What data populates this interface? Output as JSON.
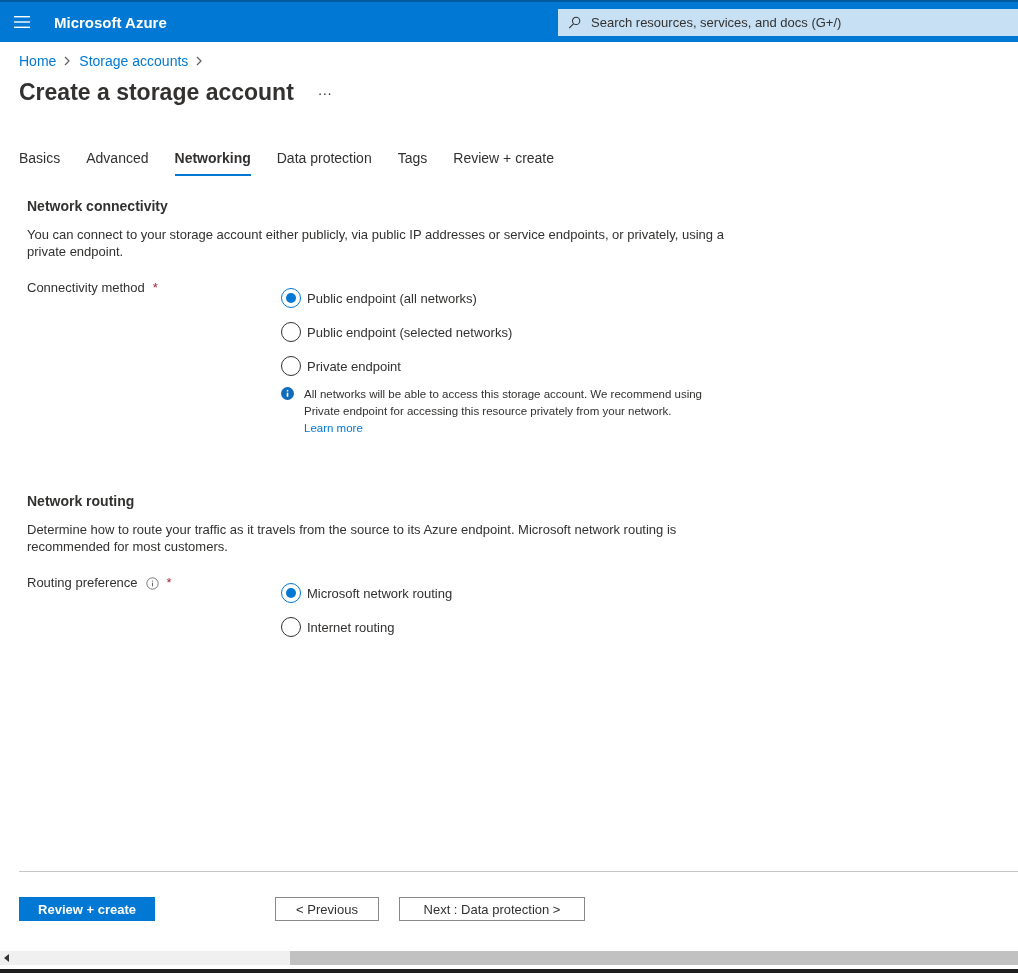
{
  "header": {
    "brand": "Microsoft Azure",
    "search": {
      "placeholder": "Search resources, services, and docs (G+/)"
    }
  },
  "breadcrumb": [
    "Home",
    "Storage accounts"
  ],
  "title": "Create a storage account",
  "more": "···",
  "tabs": [
    {
      "label": "Basics",
      "selected": false
    },
    {
      "label": "Advanced",
      "selected": false
    },
    {
      "label": "Networking",
      "selected": true
    },
    {
      "label": "Data protection",
      "selected": false
    },
    {
      "label": "Tags",
      "selected": false
    },
    {
      "label": "Review + create",
      "selected": false
    }
  ],
  "sections": [
    {
      "heading": "Network connectivity",
      "description": "You can connect to your storage account either publicly, via public IP addresses or service endpoints, or privately, using a private endpoint.",
      "field": {
        "label": "Connectivity method",
        "required": "*",
        "has_info": false,
        "options": [
          {
            "label": "Public endpoint (all networks)",
            "selected": true
          },
          {
            "label": "Public endpoint (selected networks)",
            "selected": false
          },
          {
            "label": "Private endpoint",
            "selected": false
          }
        ],
        "note": {
          "text": "All networks will be able to access this storage account. We recommend using Private endpoint for accessing this resource privately from your network.",
          "link": "Learn more"
        }
      }
    },
    {
      "heading": "Network routing",
      "description": "Determine how to route your traffic as it travels from the source to its Azure endpoint. Microsoft network routing is recommended for most customers.",
      "field": {
        "label": "Routing preference",
        "required": "*",
        "has_info": true,
        "options": [
          {
            "label": "Microsoft network routing",
            "selected": true
          },
          {
            "label": "Internet routing",
            "selected": false
          }
        ]
      }
    }
  ],
  "footer": {
    "primary": "Review + create",
    "previous": "< Previous",
    "next": "Next : Data protection >"
  }
}
